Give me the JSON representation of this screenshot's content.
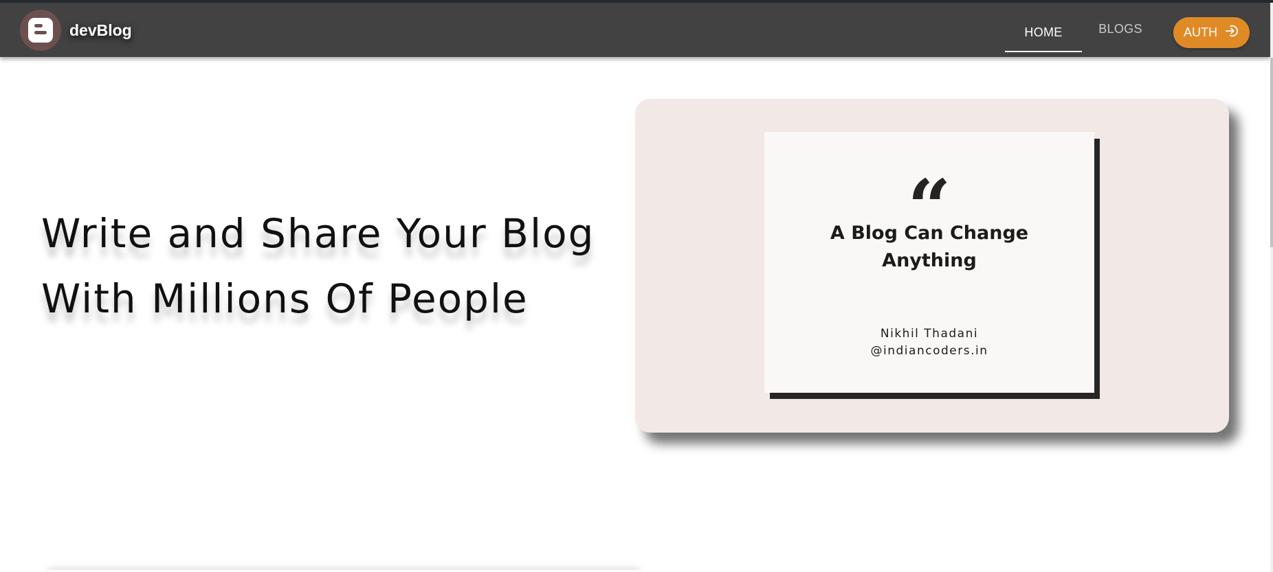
{
  "nav": {
    "brand": "devBlog",
    "tabs": [
      {
        "label": "HOME",
        "active": true
      },
      {
        "label": "BLOGS",
        "active": false
      }
    ],
    "auth_label": "AUTH"
  },
  "hero": {
    "title_line1": "Write and Share Your Blog",
    "title_line2": "With Millions Of People",
    "quote_card": {
      "quote_mark": "“",
      "quote_line1": "A Blog Can Change",
      "quote_line2": "Anything",
      "author": "Nikhil Thadani",
      "handle": "@indiancoders.in"
    }
  },
  "colors": {
    "navbar": "#424242",
    "accent": "#e08a26",
    "card_bg": "#f2e9e6"
  },
  "icons": {
    "brand_logo": "blogger-logo-icon",
    "auth": "login-arrow-icon"
  }
}
